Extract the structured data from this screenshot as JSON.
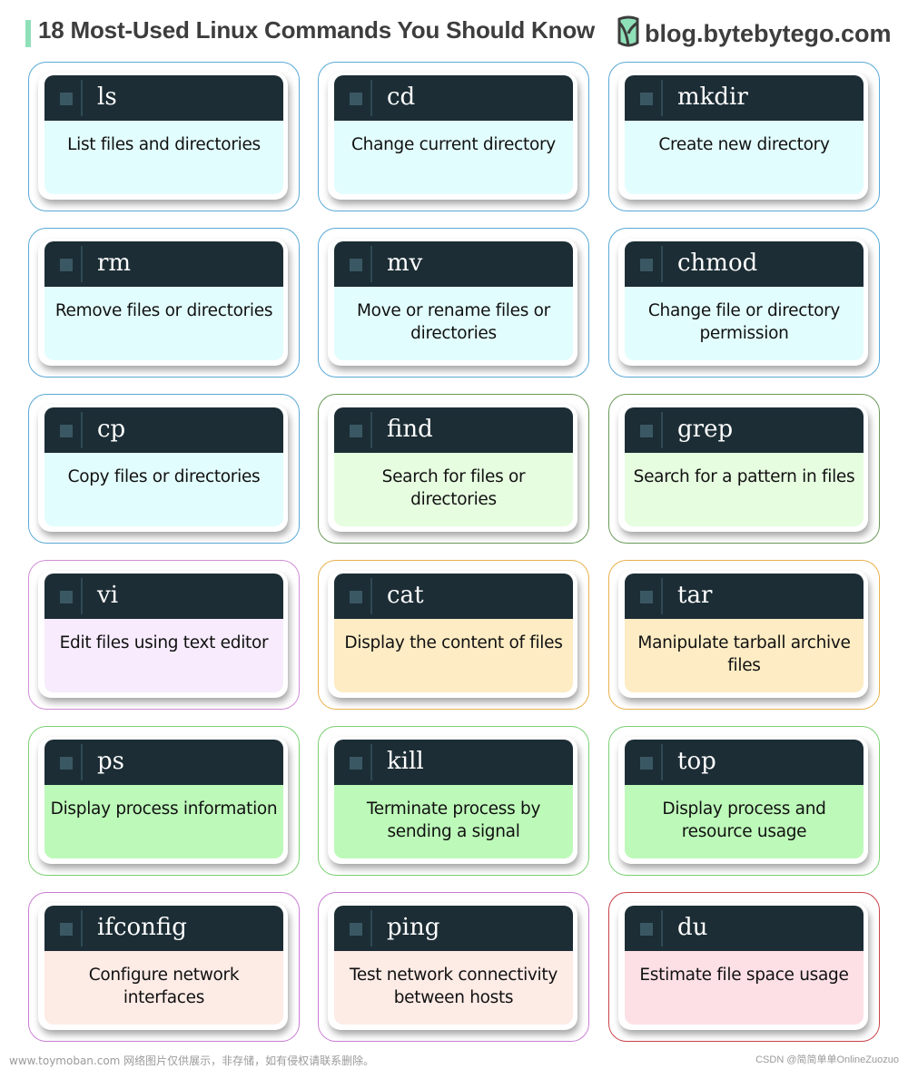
{
  "header": {
    "title": "18 Most-Used Linux Commands You Should Know",
    "brand": "blog.bytebytego.com",
    "accent_color": "#8fe0b8"
  },
  "theme": {
    "header_bg": "#1c2d35",
    "square_color": "#3a5863"
  },
  "commands": [
    {
      "name": "ls",
      "description": "List files and directories",
      "border": "#5aa9d6",
      "fill": "#e2fdfd"
    },
    {
      "name": "cd",
      "description": "Change current directory",
      "border": "#5aa9d6",
      "fill": "#e2fdfd"
    },
    {
      "name": "mkdir",
      "description": "Create new directory",
      "border": "#5aa9d6",
      "fill": "#e2fdfd"
    },
    {
      "name": "rm",
      "description": "Remove files or directories",
      "border": "#5aa9d6",
      "fill": "#e2fdfd"
    },
    {
      "name": "mv",
      "description": "Move or rename files or directories",
      "border": "#5aa9d6",
      "fill": "#e2fdfd"
    },
    {
      "name": "chmod",
      "description": "Change file or directory permission",
      "border": "#5aa9d6",
      "fill": "#e2fdfd"
    },
    {
      "name": "cp",
      "description": "Copy files or directories",
      "border": "#5aa9d6",
      "fill": "#e2fdfd"
    },
    {
      "name": "find",
      "description": "Search for files or directories",
      "border": "#6a9a5a",
      "fill": "#e6fde0"
    },
    {
      "name": "grep",
      "description": "Search for a pattern in files",
      "border": "#6a9a5a",
      "fill": "#e6fde0"
    },
    {
      "name": "vi",
      "description": "Edit files using text editor",
      "border": "#d18ed6",
      "fill": "#f7ebfd"
    },
    {
      "name": "cat",
      "description": "Display the content of files",
      "border": "#e9b24e",
      "fill": "#fdecc4"
    },
    {
      "name": "tar",
      "description": "Manipulate tarball archive files",
      "border": "#e9b24e",
      "fill": "#fdecc4"
    },
    {
      "name": "ps",
      "description": "Display process information",
      "border": "#7ccf74",
      "fill": "#bdf9b9"
    },
    {
      "name": "kill",
      "description": "Terminate process by sending a signal",
      "border": "#7ccf74",
      "fill": "#bdf9b9"
    },
    {
      "name": "top",
      "description": "Display process and resource usage",
      "border": "#7ccf74",
      "fill": "#bdf9b9"
    },
    {
      "name": "ifconfig",
      "description": "Configure network interfaces",
      "border": "#c97fd3",
      "fill": "#fdebe6"
    },
    {
      "name": "ping",
      "description": "Test network connectivity between hosts",
      "border": "#c97fd3",
      "fill": "#fdebe6"
    },
    {
      "name": "du",
      "description": "Estimate file space usage",
      "border": "#c8444a",
      "fill": "#fde0e6"
    }
  ],
  "footer": {
    "watermark_left": "www.toymoban.com 网络图片仅供展示，非存储，如有侵权请联系删除。",
    "watermark_right": "CSDN @简简单单OnlineZuozuo"
  }
}
